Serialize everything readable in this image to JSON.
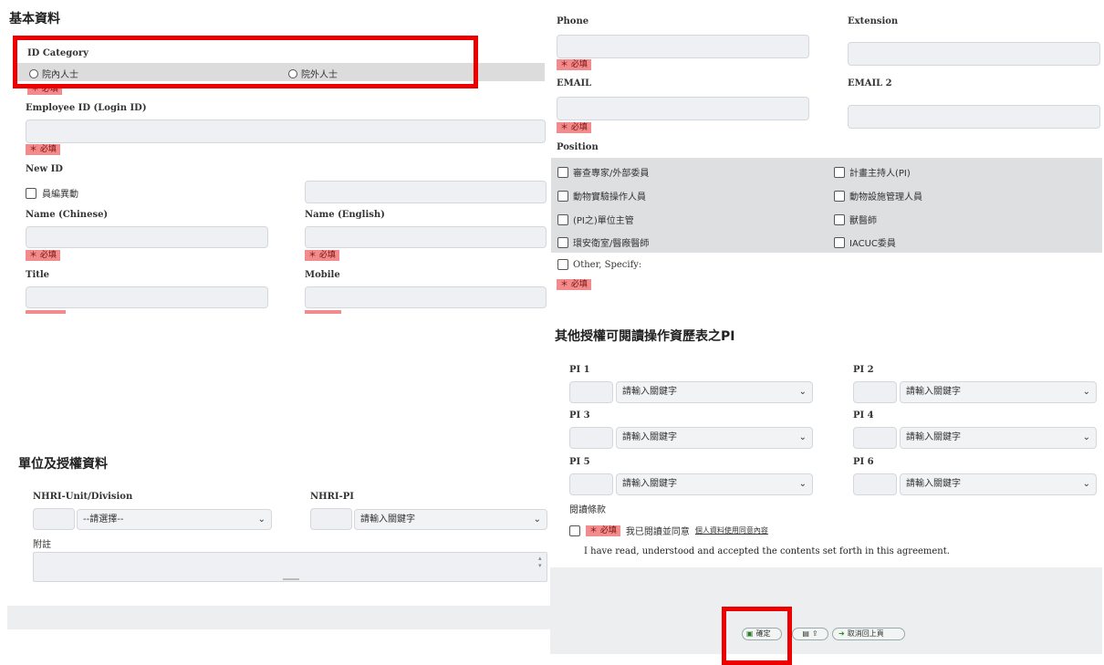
{
  "left": {
    "section_title": "基本資料",
    "id_category": {
      "label": "ID Category",
      "options": [
        "院內人士",
        "院外人士"
      ]
    },
    "required_text": "＊ 必填",
    "employee_id": {
      "label": "Employee ID (Login ID)",
      "value": ""
    },
    "new_id": {
      "label": "New ID",
      "checkbox_label": "員編異動",
      "value": ""
    },
    "name_chinese": {
      "label": "Name (Chinese)",
      "value": ""
    },
    "name_english": {
      "label": "Name (English)",
      "value": ""
    },
    "title": {
      "label": "Title",
      "value": ""
    },
    "mobile": {
      "label": "Mobile",
      "value": ""
    },
    "unit_section_title": "單位及授權資料",
    "unit": {
      "label": "NHRI-Unit/Division",
      "placeholder": "--請選擇--"
    },
    "nhri_pi": {
      "label": "NHRI-PI",
      "placeholder": "請輸入關鍵字"
    },
    "notes": {
      "label": "附註",
      "value": ""
    }
  },
  "right": {
    "phone": {
      "label": "Phone",
      "value": ""
    },
    "extension": {
      "label": "Extension",
      "value": ""
    },
    "email": {
      "label": "EMAIL",
      "value": ""
    },
    "email2": {
      "label": "EMAIL 2",
      "value": ""
    },
    "position": {
      "label": "Position",
      "items_left": [
        "審查專家/外部委員",
        "動物實驗操作人員",
        "(PI之)單位主管",
        "環安衛室/醫廠醫師"
      ],
      "items_right": [
        "計畫主持人(PI)",
        "動物設施管理人員",
        "獸醫師",
        "IACUC委員"
      ],
      "other": "Other, Specify:"
    },
    "pi_section_title": "其他授權可閱讀操作資歷表之PI",
    "pi": [
      {
        "label": "PI 1",
        "placeholder": "請輸入關鍵字"
      },
      {
        "label": "PI 2",
        "placeholder": "請輸入關鍵字"
      },
      {
        "label": "PI 3",
        "placeholder": "請輸入關鍵字"
      },
      {
        "label": "PI 4",
        "placeholder": "請輸入關鍵字"
      },
      {
        "label": "PI 5",
        "placeholder": "請輸入關鍵字"
      },
      {
        "label": "PI 6",
        "placeholder": "請輸入關鍵字"
      }
    ],
    "terms": {
      "label": "閱讀條款",
      "agree_text": "我已閱讀並同意",
      "link_text": "個人資料使用同意內容",
      "statement": "I have read, understood and accepted the contents set forth in this agreement."
    },
    "buttons": {
      "confirm": "確定",
      "print": "",
      "cancel": "取消回上頁"
    }
  }
}
